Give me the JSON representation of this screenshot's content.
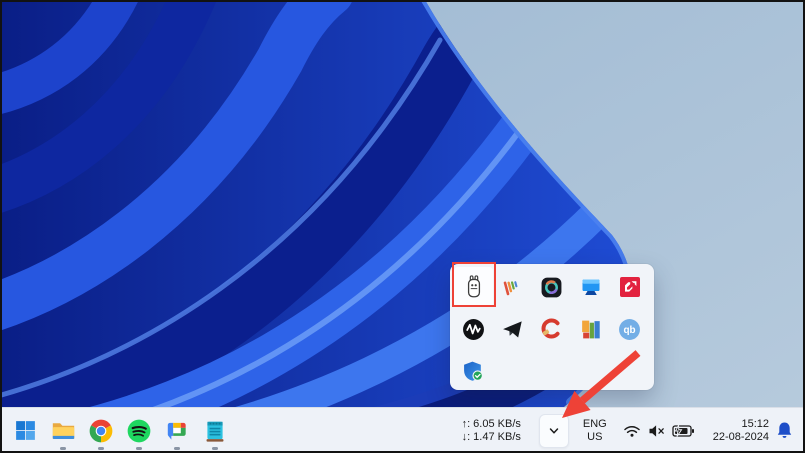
{
  "desktop": {
    "wallpaper": "windows-11-bloom"
  },
  "taskbar": {
    "start_button": {
      "icon": "windows-start-icon"
    },
    "pinned_apps": [
      {
        "icon": "file-explorer-icon",
        "running": true
      },
      {
        "icon": "chrome-icon",
        "running": true
      },
      {
        "icon": "spotify-icon",
        "running": true
      },
      {
        "icon": "google-chat-icon",
        "running": true
      },
      {
        "icon": "notepad-icon",
        "running": true
      }
    ],
    "net_speed": {
      "up": "↑: 6.05 KB/s",
      "down": "↓: 1.47 KB/s"
    },
    "tray": {
      "chevron_icon": "chevron-down-icon",
      "language": {
        "line1": "ENG",
        "line2": "US"
      },
      "status_icons": [
        "wifi-icon",
        "volume-muted-icon",
        "battery-charging-icon"
      ],
      "clock": {
        "time": "15:12",
        "date": "22-08-2024"
      },
      "bell_icon": "notification-bell-icon",
      "bell_color": "#1d4ec8"
    }
  },
  "tray_flyout": {
    "qb_label": "qb",
    "icons": [
      {
        "name": "ollama-icon",
        "highlighted": true
      },
      {
        "name": "stripes-app-icon"
      },
      {
        "name": "dark-ring-app-icon"
      },
      {
        "name": "display-app-icon"
      },
      {
        "name": "amd-radeon-icon"
      },
      {
        "name": "audio-waveform-icon"
      },
      {
        "name": "telegram-icon"
      },
      {
        "name": "ccleaner-icon"
      },
      {
        "name": "tuneup-blocks-icon"
      },
      {
        "name": "qbittorrent-icon"
      },
      {
        "name": "windows-security-icon"
      }
    ]
  },
  "annotations": {
    "box_color": "#ee4237",
    "arrow_color": "#ee4237"
  },
  "colors": {
    "taskbar_bg": "#eef2f8",
    "flyout_bg": "#f1f4f9",
    "wallpaper_light": "#a6c0d6",
    "wallpaper_deep": "#0a1e86",
    "wallpaper_bright": "#2e63e8"
  }
}
